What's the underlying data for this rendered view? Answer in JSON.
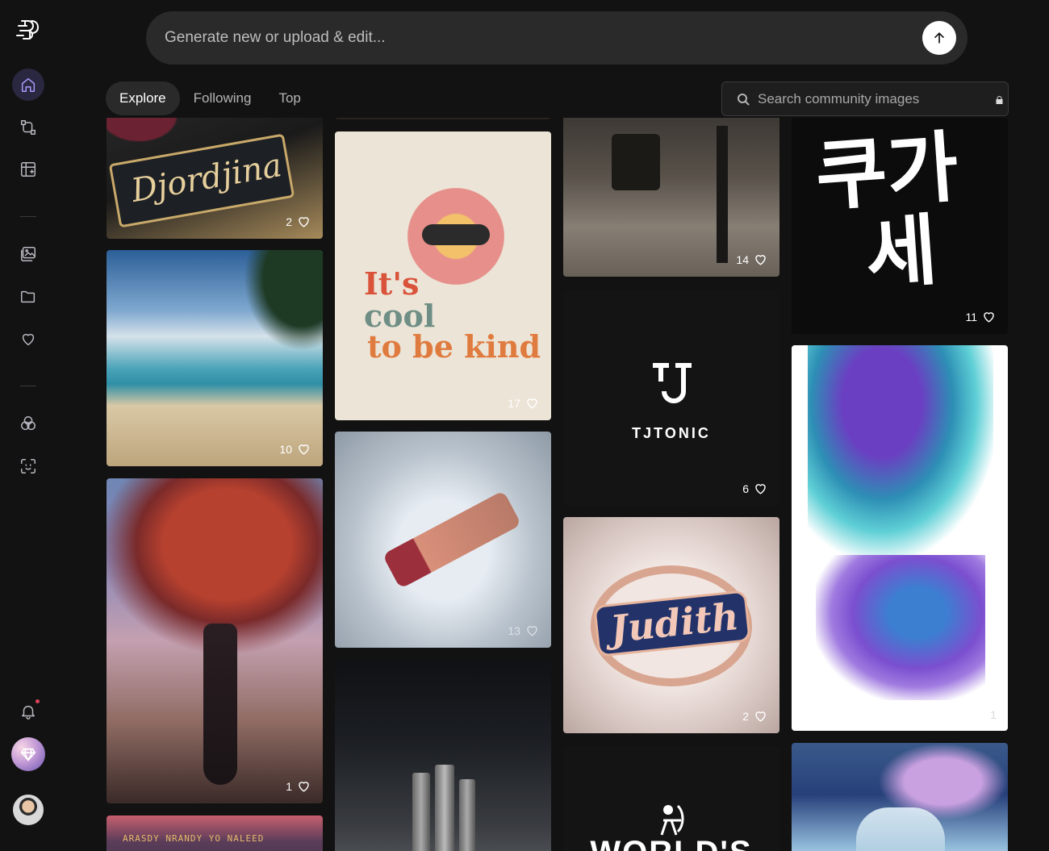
{
  "prompt": {
    "placeholder": "Generate new or upload & edit..."
  },
  "tabs": [
    {
      "label": "Explore",
      "active": true
    },
    {
      "label": "Following",
      "active": false
    },
    {
      "label": "Top",
      "active": false
    }
  ],
  "search": {
    "placeholder": "Search community images"
  },
  "sidebar": {
    "items": [
      {
        "icon": "home-icon",
        "active": true
      },
      {
        "icon": "workflow-icon"
      },
      {
        "icon": "add-board-icon"
      },
      {
        "icon": "images-icon"
      },
      {
        "icon": "folder-icon"
      },
      {
        "icon": "heart-icon"
      },
      {
        "icon": "blend-icon"
      },
      {
        "icon": "face-scan-icon"
      },
      {
        "icon": "bell-icon"
      }
    ]
  },
  "cards": [
    {
      "title": "Djordjina",
      "likes": "2"
    },
    {
      "likes": "10"
    },
    {
      "likes": "1"
    },
    {
      "caption": "ARASDY NRANDY YO NALEED"
    },
    {
      "text": [
        "It's",
        "cool",
        "to be kind"
      ],
      "likes": "17"
    },
    {
      "likes": "13"
    },
    {
      "likes": "14"
    },
    {
      "brand": "TJTONIC",
      "likes": "6"
    },
    {
      "title": "Judith",
      "likes": "2"
    },
    {
      "headline": "WORLD'S"
    },
    {
      "text": [
        "쿠가",
        "세"
      ],
      "likes": "11"
    },
    {
      "likes": "1"
    }
  ]
}
